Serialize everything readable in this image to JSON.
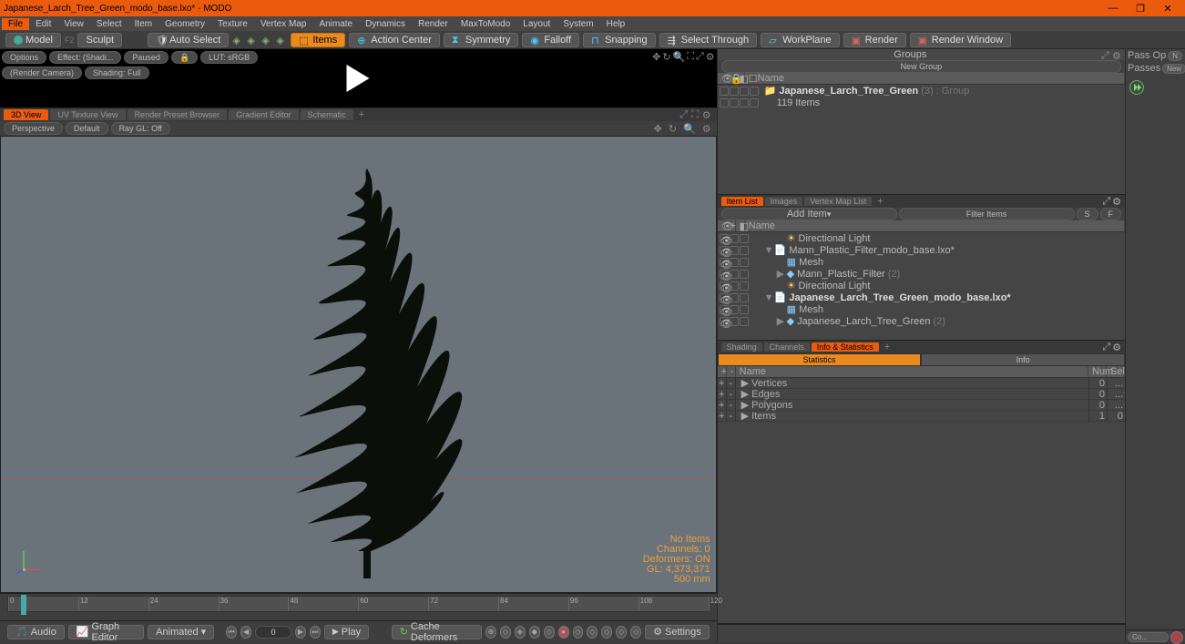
{
  "titlebar": {
    "title": "Japanese_Larch_Tree_Green_modo_base.lxo* - MODO"
  },
  "menubar": [
    "File",
    "Edit",
    "View",
    "Select",
    "Item",
    "Geometry",
    "Texture",
    "Vertex Map",
    "Animate",
    "Dynamics",
    "Render",
    "MaxToModo",
    "Layout",
    "System",
    "Help"
  ],
  "modebar": {
    "model": "Model",
    "model_key": "F2",
    "sculpt": "Sculpt",
    "auto_select": "Auto Select",
    "items": "Items",
    "action_center": "Action Center",
    "symmetry": "Symmetry",
    "falloff": "Falloff",
    "snapping": "Snapping",
    "select_through": "Select Through",
    "workplane": "WorkPlane",
    "render": "Render",
    "render_window": "Render Window"
  },
  "render_preview": {
    "options": "Options",
    "effect": "Effect: (Shadi...",
    "paused": "Paused",
    "lut": "LUT: sRGB",
    "camera": "(Render Camera)",
    "shading": "Shading: Full"
  },
  "view_tabs": [
    "3D View",
    "UV Texture View",
    "Render Preset Browser",
    "Gradient Editor",
    "Schematic"
  ],
  "view_toolbar": {
    "perspective": "Perspective",
    "default": "Default",
    "ray": "Ray GL: Off"
  },
  "viewport_stats": {
    "no_items": "No Items",
    "channels": "Channels: 0",
    "deformers": "Deformers: ON",
    "gl": "GL: 4,373,371",
    "scale": "500 mm"
  },
  "timeline": {
    "start": 0,
    "end": 120,
    "ticks": [
      0,
      12,
      24,
      36,
      48,
      60,
      72,
      84,
      96,
      108,
      120
    ]
  },
  "bottom": {
    "audio": "Audio",
    "graph": "Graph Editor",
    "animated": "Animated",
    "frame": "0",
    "play": "Play",
    "cache": "Cache Deformers",
    "settings": "Settings"
  },
  "groups": {
    "title": "Groups",
    "new_group": "New Group",
    "name_col": "Name",
    "items": [
      {
        "label": "Japanese_Larch_Tree_Green",
        "suffix": "(3) : Group",
        "indent": 0,
        "icon": "folder",
        "bold": true
      },
      {
        "label": "119 Items",
        "indent": 1,
        "icon": "none"
      }
    ]
  },
  "item_list": {
    "tabs": [
      "Item List",
      "Images",
      "Vertex Map List"
    ],
    "add_item": "Add Item",
    "filter": "Filter Items",
    "name_col": "Name",
    "items": [
      {
        "label": "Directional Light",
        "indent": 1,
        "icon": "light",
        "expander": ""
      },
      {
        "label": "Mann_Plastic_Filter_modo_base.lxo*",
        "indent": 0,
        "icon": "scene",
        "expander": "▼"
      },
      {
        "label": "Mesh",
        "indent": 1,
        "icon": "mesh",
        "expander": ""
      },
      {
        "label": "Mann_Plastic_Filter",
        "suffix": "(2)",
        "indent": 1,
        "icon": "loc",
        "expander": "▶"
      },
      {
        "label": "Directional Light",
        "indent": 1,
        "icon": "light",
        "expander": ""
      },
      {
        "label": "Japanese_Larch_Tree_Green_modo_base.lxo*",
        "indent": 0,
        "icon": "scene",
        "expander": "▼",
        "bold": true
      },
      {
        "label": "Mesh",
        "indent": 1,
        "icon": "mesh",
        "expander": ""
      },
      {
        "label": "Japanese_Larch_Tree_Green",
        "suffix": "(2)",
        "indent": 1,
        "icon": "loc",
        "expander": "▶"
      }
    ]
  },
  "info_panel": {
    "tabs": [
      "Shading",
      "Channels",
      "Info & Statistics"
    ],
    "sub_tabs": [
      "Statistics",
      "Info"
    ],
    "name_col": "Name",
    "num_col": "Num",
    "sel_col": "Sel",
    "rows": [
      {
        "name": "Vertices",
        "num": "0",
        "sel": "..."
      },
      {
        "name": "Edges",
        "num": "0",
        "sel": "..."
      },
      {
        "name": "Polygons",
        "num": "0",
        "sel": "..."
      },
      {
        "name": "Items",
        "num": "1",
        "sel": "0"
      }
    ]
  },
  "far_right": {
    "pass_opt": "Pass Op",
    "n": "N",
    "passes": "Passes",
    "new": "New",
    "play": ">>",
    "co": "Co..."
  }
}
